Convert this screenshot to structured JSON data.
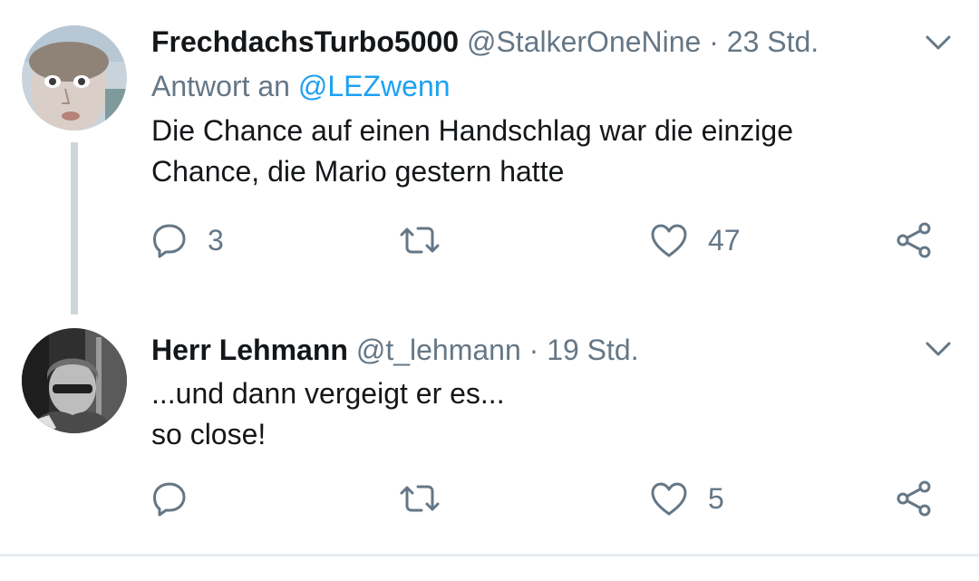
{
  "tweets": [
    {
      "name": "FrechdachsTurbo5000",
      "handle": "@StalkerOneNine",
      "separator": "·",
      "time": "23 Std.",
      "reply_prefix": "Antwort an",
      "reply_mention": "@LEZwenn",
      "text_lines": [
        "Die Chance auf einen Handschlag war die einzige",
        "Chance, die Mario gestern hatte"
      ],
      "reply_count": "3",
      "retweet_count": "",
      "like_count": "47"
    },
    {
      "name": "Herr Lehmann",
      "handle": "@t_lehmann",
      "separator": "·",
      "time": "19 Std.",
      "text_lines": [
        "...und dann vergeigt er es...",
        "so close!"
      ],
      "reply_count": "",
      "retweet_count": "",
      "like_count": "5"
    }
  ],
  "colors": {
    "secondary_text": "#657786",
    "link": "#1da1f2",
    "thread_line": "#ccd6dd",
    "primary_text": "#14171a"
  },
  "icons": [
    "reply-icon",
    "retweet-icon",
    "like-icon",
    "share-icon",
    "chevron-down-icon"
  ]
}
